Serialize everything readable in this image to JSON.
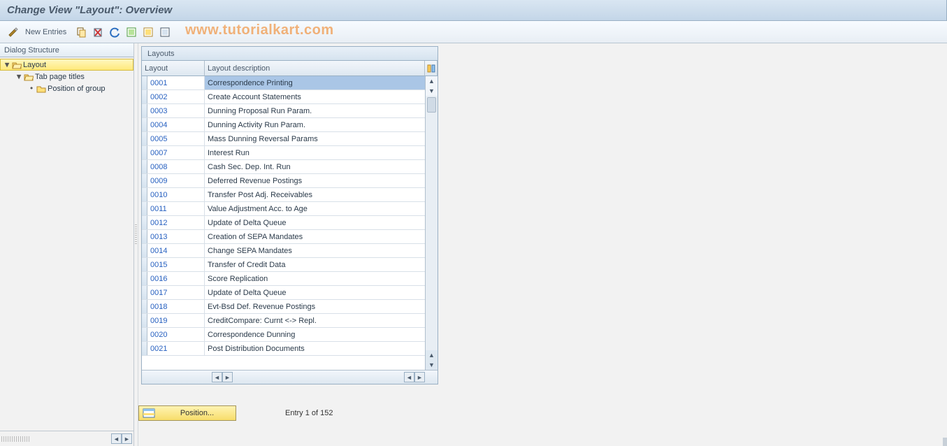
{
  "header": {
    "title": "Change View \"Layout\": Overview"
  },
  "toolbar": {
    "new_entries": "New Entries"
  },
  "watermark": "www.tutorialkart.com",
  "dialog_structure": {
    "title": "Dialog Structure",
    "nodes": [
      {
        "label": "Layout",
        "open": true,
        "sel": true,
        "indent": 0
      },
      {
        "label": "Tab page titles",
        "open": true,
        "sel": false,
        "indent": 1
      },
      {
        "label": "Position of group",
        "open": false,
        "sel": false,
        "indent": 2,
        "leaf": true
      }
    ]
  },
  "grid": {
    "title": "Layouts",
    "columns": {
      "c1": "Layout",
      "c2": "Layout description"
    },
    "rows": [
      {
        "id": "0001",
        "desc": "Correspondence Printing",
        "current": true
      },
      {
        "id": "0002",
        "desc": "Create Account Statements"
      },
      {
        "id": "0003",
        "desc": "Dunning Proposal Run Param."
      },
      {
        "id": "0004",
        "desc": "Dunning Activity Run Param."
      },
      {
        "id": "0005",
        "desc": "Mass Dunning Reversal Params"
      },
      {
        "id": "0007",
        "desc": "Interest Run"
      },
      {
        "id": "0008",
        "desc": "Cash Sec. Dep. Int. Run"
      },
      {
        "id": "0009",
        "desc": "Deferred Revenue Postings"
      },
      {
        "id": "0010",
        "desc": "Transfer Post Adj. Receivables"
      },
      {
        "id": "0011",
        "desc": "Value Adjustment Acc. to Age"
      },
      {
        "id": "0012",
        "desc": "Update of Delta Queue"
      },
      {
        "id": "0013",
        "desc": "Creation of SEPA Mandates"
      },
      {
        "id": "0014",
        "desc": "Change SEPA Mandates"
      },
      {
        "id": "0015",
        "desc": "Transfer of Credit Data"
      },
      {
        "id": "0016",
        "desc": "Score Replication"
      },
      {
        "id": "0017",
        "desc": "Update of Delta Queue"
      },
      {
        "id": "0018",
        "desc": "Evt-Bsd Def. Revenue Postings"
      },
      {
        "id": "0019",
        "desc": "CreditCompare: Curnt <-> Repl."
      },
      {
        "id": "0020",
        "desc": "Correspondence Dunning"
      },
      {
        "id": "0021",
        "desc": "Post Distribution Documents"
      }
    ]
  },
  "status": {
    "position_btn": "Position...",
    "entry": "Entry 1 of 152"
  }
}
